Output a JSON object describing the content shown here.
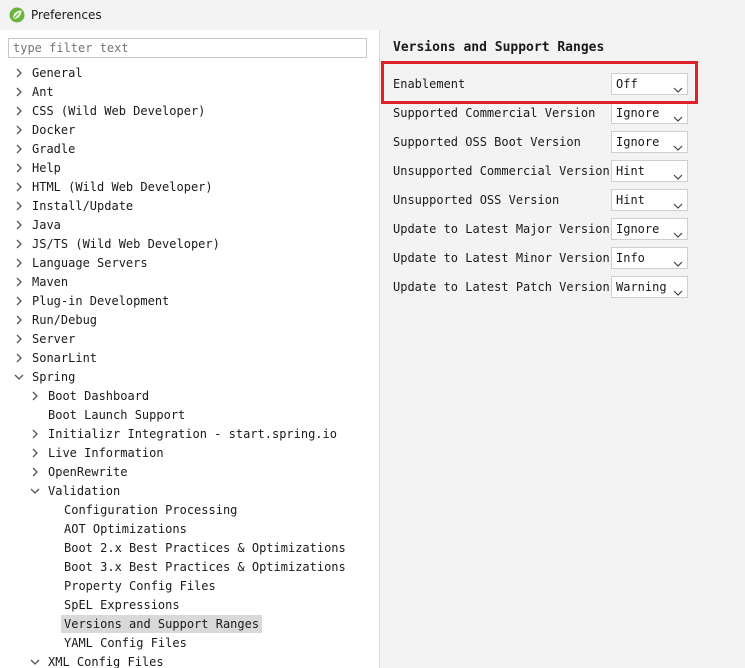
{
  "window": {
    "title": "Preferences",
    "icon": "spring-leaf-icon",
    "accent": "#e0202a"
  },
  "filter": {
    "placeholder": "type filter text"
  },
  "tree": [
    {
      "label": "General",
      "level": 0,
      "state": "collapsed"
    },
    {
      "label": "Ant",
      "level": 0,
      "state": "collapsed"
    },
    {
      "label": "CSS (Wild Web Developer)",
      "level": 0,
      "state": "collapsed"
    },
    {
      "label": "Docker",
      "level": 0,
      "state": "collapsed"
    },
    {
      "label": "Gradle",
      "level": 0,
      "state": "collapsed"
    },
    {
      "label": "Help",
      "level": 0,
      "state": "collapsed"
    },
    {
      "label": "HTML (Wild Web Developer)",
      "level": 0,
      "state": "collapsed"
    },
    {
      "label": "Install/Update",
      "level": 0,
      "state": "collapsed"
    },
    {
      "label": "Java",
      "level": 0,
      "state": "collapsed"
    },
    {
      "label": "JS/TS (Wild Web Developer)",
      "level": 0,
      "state": "collapsed"
    },
    {
      "label": "Language Servers",
      "level": 0,
      "state": "collapsed"
    },
    {
      "label": "Maven",
      "level": 0,
      "state": "collapsed"
    },
    {
      "label": "Plug-in Development",
      "level": 0,
      "state": "collapsed"
    },
    {
      "label": "Run/Debug",
      "level": 0,
      "state": "collapsed"
    },
    {
      "label": "Server",
      "level": 0,
      "state": "collapsed"
    },
    {
      "label": "SonarLint",
      "level": 0,
      "state": "collapsed"
    },
    {
      "label": "Spring",
      "level": 0,
      "state": "expanded"
    },
    {
      "label": "Boot Dashboard",
      "level": 1,
      "state": "collapsed"
    },
    {
      "label": "Boot Launch Support",
      "level": 1,
      "state": "leaf"
    },
    {
      "label": "Initializr Integration - start.spring.io",
      "level": 1,
      "state": "collapsed"
    },
    {
      "label": "Live Information",
      "level": 1,
      "state": "collapsed"
    },
    {
      "label": "OpenRewrite",
      "level": 1,
      "state": "collapsed"
    },
    {
      "label": "Validation",
      "level": 1,
      "state": "expanded"
    },
    {
      "label": "Configuration Processing",
      "level": 2,
      "state": "leaf"
    },
    {
      "label": "AOT Optimizations",
      "level": 2,
      "state": "leaf"
    },
    {
      "label": "Boot 2.x Best Practices & Optimizations",
      "level": 2,
      "state": "leaf"
    },
    {
      "label": "Boot 3.x Best Practices & Optimizations",
      "level": 2,
      "state": "leaf"
    },
    {
      "label": "Property Config Files",
      "level": 2,
      "state": "leaf"
    },
    {
      "label": "SpEL Expressions",
      "level": 2,
      "state": "leaf"
    },
    {
      "label": "Versions and Support Ranges",
      "level": 2,
      "state": "leaf",
      "selected": true
    },
    {
      "label": "YAML Config Files",
      "level": 2,
      "state": "leaf"
    },
    {
      "label": "XML Config Files",
      "level": 1,
      "state": "expanded"
    }
  ],
  "page": {
    "title": "Versions and Support Ranges",
    "settings": [
      {
        "label": "Enablement",
        "value": "Off",
        "highlighted": true
      },
      {
        "label": "Supported Commercial Version",
        "value": "Ignore"
      },
      {
        "label": "Supported OSS Boot Version",
        "value": "Ignore"
      },
      {
        "label": "Unsupported Commercial Version",
        "value": "Hint"
      },
      {
        "label": "Unsupported OSS Version",
        "value": "Hint"
      },
      {
        "label": "Update to Latest Major Version",
        "value": "Ignore"
      },
      {
        "label": "Update to Latest Minor Version",
        "value": "Info"
      },
      {
        "label": "Update to Latest Patch Version",
        "value": "Warning"
      }
    ]
  }
}
